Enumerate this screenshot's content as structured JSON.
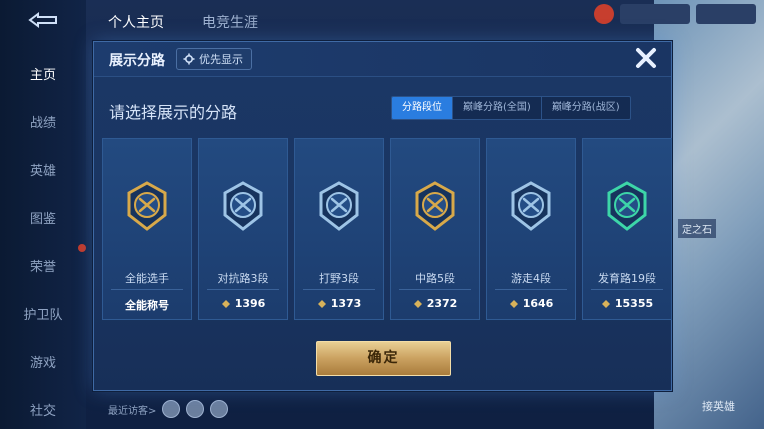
{
  "background": {
    "top_tabs": [
      "个人主页",
      "电竞生涯"
    ],
    "nav_items": [
      "主页",
      "战绩",
      "英雄",
      "图鉴",
      "荣誉",
      "护卫队",
      "游戏",
      "社交"
    ],
    "active_nav": "主页",
    "visitors_label": "最近访客>",
    "side_label": "定之石",
    "bottom_right_label": "接英雄"
  },
  "dialog": {
    "title": "展示分路",
    "priority_button": "优先显示",
    "prompt": "请选择展示的分路",
    "tabs": [
      "分路段位",
      "巅峰分路(全国)",
      "巅峰分路(战区)"
    ],
    "active_tab": "分路段位",
    "cards": [
      {
        "name": "全能选手",
        "score": "全能称号",
        "emblem": "all-round-emblem-icon",
        "color": "#d8a94a"
      },
      {
        "name": "对抗路3段",
        "score": "1396",
        "emblem": "clash-lane-emblem-icon",
        "color": "#9ec4e6"
      },
      {
        "name": "打野3段",
        "score": "1373",
        "emblem": "jungle-emblem-icon",
        "color": "#9ec4e6"
      },
      {
        "name": "中路5段",
        "score": "2372",
        "emblem": "mid-lane-emblem-icon",
        "color": "#d8a94a"
      },
      {
        "name": "游走4段",
        "score": "1646",
        "emblem": "roam-emblem-icon",
        "color": "#9ec4e6"
      },
      {
        "name": "发育路19段",
        "score": "15355",
        "emblem": "farm-lane-emblem-icon",
        "color": "#3dd6a8"
      }
    ],
    "confirm_button": "确定"
  },
  "colors": {
    "accent_blue": "#2a7de0",
    "gold": "#caa160"
  }
}
